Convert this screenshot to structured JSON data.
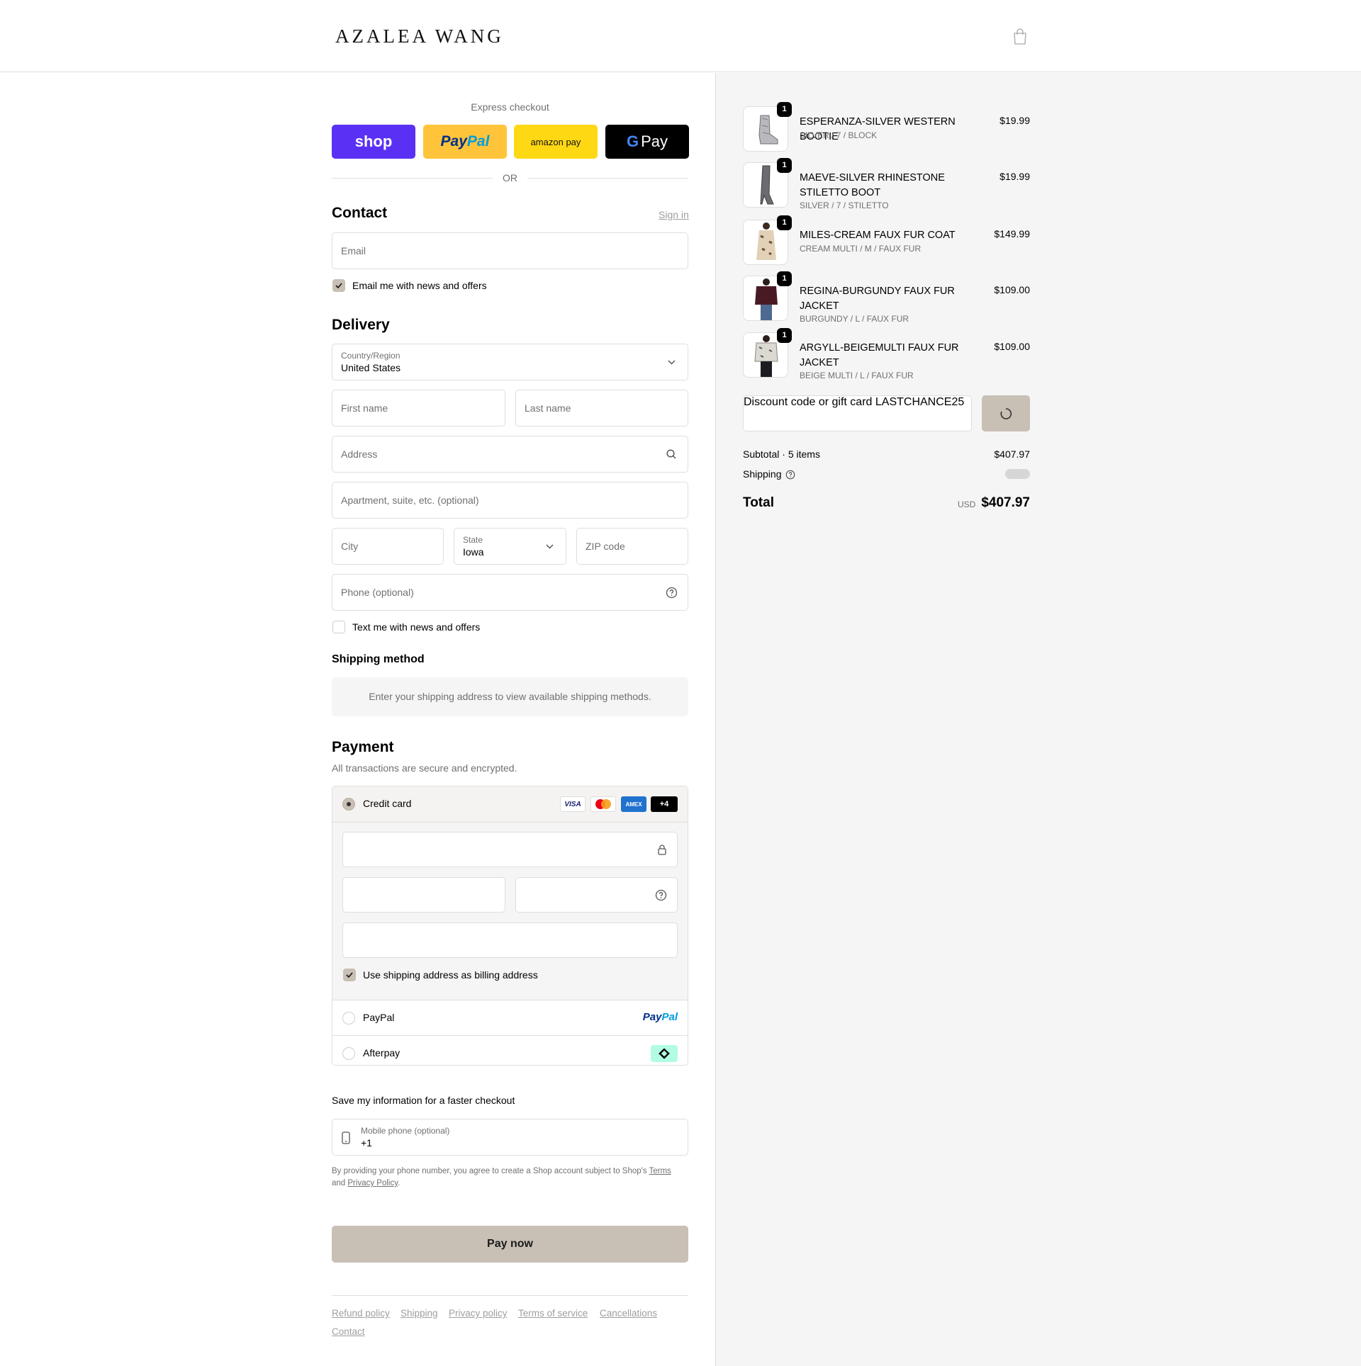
{
  "header": {
    "logo": "AZALEA WANG",
    "cart_icon": "shopping-bag-icon"
  },
  "express": {
    "title": "Express checkout",
    "shop_label": "shop",
    "paypal_label_pay": "Pay",
    "paypal_label_pal": "Pal",
    "amazon_label": "amazon pay",
    "gpay_label": "Pay",
    "or_label": "OR"
  },
  "contact": {
    "heading": "Contact",
    "sign_in": "Sign in",
    "email_placeholder": "Email",
    "news_checkbox_label": "Email me with news and offers",
    "news_checked": true
  },
  "delivery": {
    "heading": "Delivery",
    "country_label": "Country/Region",
    "country_value": "United States",
    "first_name_placeholder": "First name",
    "last_name_placeholder": "Last name",
    "address_placeholder": "Address",
    "apartment_placeholder": "Apartment, suite, etc. (optional)",
    "city_placeholder": "City",
    "state_label": "State",
    "state_value": "Iowa",
    "zip_placeholder": "ZIP code",
    "phone_placeholder": "Phone (optional)",
    "text_checkbox_label": "Text me with news and offers",
    "text_checked": false
  },
  "shipping_method": {
    "heading": "Shipping method",
    "message": "Enter your shipping address to view available shipping methods."
  },
  "payment": {
    "heading": "Payment",
    "subtitle": "All transactions are secure and encrypted.",
    "credit_card_label": "Credit card",
    "card_brands": [
      "VISA",
      "mastercard",
      "AMEX",
      "+4"
    ],
    "billing_checkbox_label": "Use shipping address as billing address",
    "billing_checked": true,
    "paypal_label": "PayPal",
    "afterpay_label": "Afterpay"
  },
  "save_info": {
    "title": "Save my information for a faster checkout",
    "mobile_label": "Mobile phone (optional)",
    "mobile_value": "+1",
    "legal_text": "By providing your phone number, you agree to create a Shop account subject to Shop's",
    "terms_link": "Terms",
    "and_text": "and",
    "privacy_link": "Privacy Policy",
    "period": "."
  },
  "pay_now_label": "Pay now",
  "footer_links": [
    "Refund policy",
    "Shipping",
    "Privacy policy",
    "Terms of service",
    "Cancellations",
    "Contact"
  ],
  "order": {
    "items": [
      {
        "name": "ESPERANZA-SILVER WESTERN BOOTIE",
        "variant": "SILVER / 7 / BLOCK",
        "price": "$19.99",
        "qty": "1"
      },
      {
        "name": "MAEVE-SILVER RHINESTONE STILETTO BOOT",
        "variant": "SILVER / 7 / STILETTO",
        "price": "$19.99",
        "qty": "1"
      },
      {
        "name": "MILES-CREAM FAUX FUR COAT",
        "variant": "CREAM MULTI / M / FAUX FUR",
        "price": "$149.99",
        "qty": "1"
      },
      {
        "name": "REGINA-BURGUNDY FAUX FUR JACKET",
        "variant": "BURGUNDY / L / FAUX FUR",
        "price": "$109.00",
        "qty": "1"
      },
      {
        "name": "ARGYLL-BEIGEMULTI FAUX FUR JACKET",
        "variant": "BEIGE MULTI / L / FAUX FUR",
        "price": "$109.00",
        "qty": "1"
      }
    ],
    "discount_label": "Discount code or gift card",
    "discount_value": "LASTCHANCE25",
    "subtotal_label": "Subtotal · 5 items",
    "subtotal_value": "$407.97",
    "shipping_label": "Shipping",
    "total_label": "Total",
    "total_currency": "USD",
    "total_value": "$407.97"
  },
  "colors": {
    "accent_button": "#c8bfb5",
    "shop_purple": "#5a31f4",
    "paypal_yellow": "#ffc439",
    "amazon_yellow": "#ffd814",
    "afterpay_mint": "#b2fce4"
  }
}
